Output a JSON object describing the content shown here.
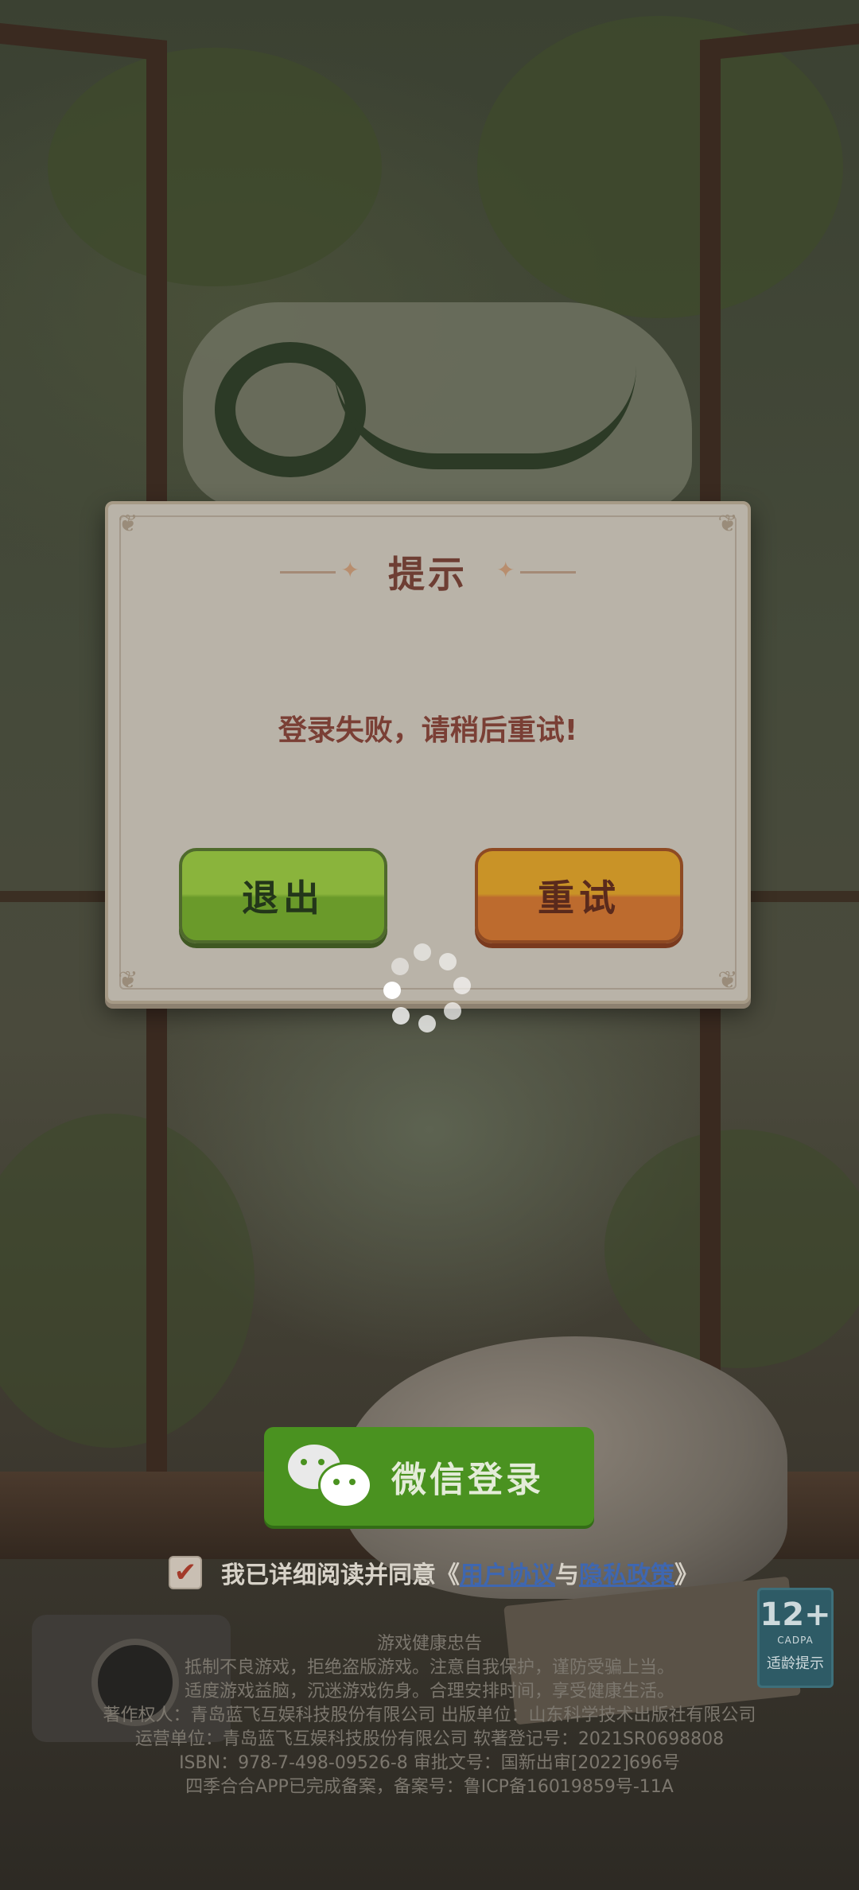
{
  "dialog": {
    "title": "提示",
    "message": "登录失败，请稍后重试!",
    "exit_label": "退出",
    "retry_label": "重试"
  },
  "login": {
    "wechat_label": "微信登录",
    "agree_prefix": "我已详细阅读并同意《",
    "user_agreement": "用户协议",
    "and": "与",
    "privacy_policy": "隐私政策",
    "agree_suffix": "》",
    "checked": true
  },
  "age_rating": {
    "number": "12+",
    "org": "CADPA",
    "hint": "适龄提示"
  },
  "health_notice": {
    "title": "游戏健康忠告",
    "line1": "抵制不良游戏，拒绝盗版游戏。注意自我保护，谨防受骗上当。",
    "line2": "适度游戏益脑，沉迷游戏伤身。合理安排时间，享受健康生活。",
    "line3": "著作权人：青岛蓝飞互娱科技股份有限公司 出版单位：山东科学技术出版社有限公司",
    "line4": "运营单位：青岛蓝飞互娱科技股份有限公司  软著登记号：2021SR0698808",
    "line5": "ISBN：978-7-498-09526-8 审批文号：国新出审[2022]696号",
    "line6": "四季合合APP已完成备案，备案号：鲁ICP备16019859号-11A"
  },
  "colors": {
    "dialog_bg": "#b9b3a8",
    "title": "#6e3e33",
    "exit_button": "#8ab43c",
    "retry_button": "#c99327",
    "wechat_button": "#4a9220",
    "link": "#3f67b0"
  }
}
